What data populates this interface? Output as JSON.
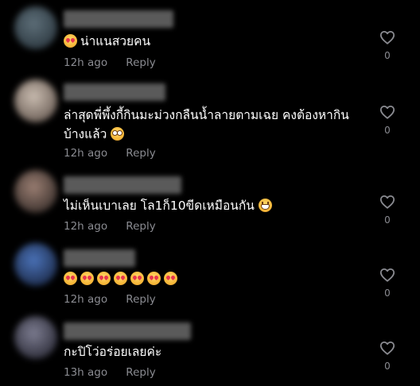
{
  "comments": [
    {
      "text": "น่าแนสวยคน",
      "emojis": [
        "smiling-face-with-heart-eyes"
      ],
      "emoji_position": "before",
      "time": "12h ago",
      "reply_label": "Reply",
      "like_count": "0",
      "avatar_colors": [
        "#5d6e78",
        "#2c3840"
      ]
    },
    {
      "text": "ล่าสุดพี่พึ้งกี้กินมะม่วงกลืนน้ำลายตามเฉย คงต้องหากินบ้างแล้ว",
      "emojis": [
        "flushed-face"
      ],
      "emoji_position": "after",
      "time": "12h ago",
      "reply_label": "Reply",
      "like_count": "0",
      "avatar_colors": [
        "#c9bcb0",
        "#6a5d55"
      ]
    },
    {
      "text": "ไม่เห็นเบาเลย โล1ก็10ขีดเหมือนกัน",
      "emojis": [
        "grinning-face-with-teeth"
      ],
      "emoji_position": "after",
      "time": "12h ago",
      "reply_label": "Reply",
      "like_count": "0",
      "avatar_colors": [
        "#9a7e72",
        "#3a302c"
      ]
    },
    {
      "text": "",
      "emojis": [
        "smiling-face-with-heart-eyes",
        "smiling-face-with-heart-eyes",
        "smiling-face-with-heart-eyes",
        "smiling-face-with-heart-eyes",
        "smiling-face-with-heart-eyes",
        "smiling-face-with-heart-eyes",
        "smiling-face-with-heart-eyes"
      ],
      "emoji_position": "after",
      "time": "12h ago",
      "reply_label": "Reply",
      "like_count": "0",
      "avatar_colors": [
        "#4a72b8",
        "#1c2a48"
      ]
    },
    {
      "text": "กะปิโว่อร่อยเลยค่ะ",
      "emojis": [],
      "emoji_position": "after",
      "time": "13h ago",
      "reply_label": "Reply",
      "like_count": "0",
      "avatar_colors": [
        "#7c7c90",
        "#2c2c38"
      ]
    }
  ],
  "colors": {
    "background": "#000000",
    "text": "#ffffff",
    "muted": "#8a8b91",
    "username_blur": "#5a5a5a"
  },
  "icons": {
    "like": "heart-outline-icon"
  }
}
